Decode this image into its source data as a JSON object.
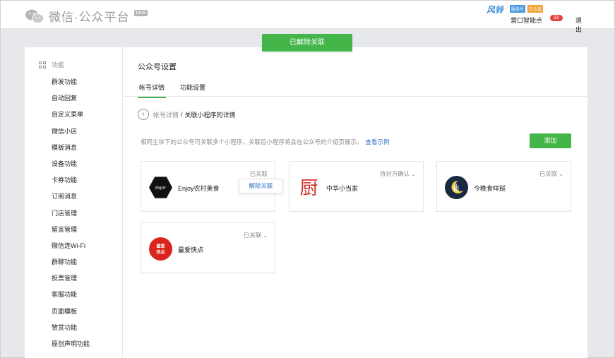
{
  "header": {
    "platform_title": "微信·公众平台",
    "beta_tag": "beta",
    "account_avatar_text": "风铃",
    "badge_1": "服务号",
    "badge_2": "已认证",
    "account_name": "营口智能点",
    "notice_count": "31",
    "logout": "退出"
  },
  "toast": {
    "text": "已解除关联"
  },
  "sidebar": {
    "section_title": "功能",
    "items": [
      "群发功能",
      "自动回复",
      "自定义菜单",
      "微信小店",
      "模板消息",
      "设备功能",
      "卡券功能",
      "订阅消息",
      "门店管理",
      "留言管理",
      "微信连Wi-Fi",
      "群聊功能",
      "投票管理",
      "客服功能",
      "页面模板",
      "赞赏功能",
      "原创声明功能"
    ]
  },
  "main": {
    "title": "公众号设置",
    "tabs": [
      {
        "label": "帐号详情",
        "active": true
      },
      {
        "label": "功能设置",
        "active": false
      }
    ],
    "breadcrumb": {
      "parent": "帐号详情",
      "separator": "/",
      "current": "关联小程序的详情"
    },
    "description": "相同主体下的公众号可关联多个小程序。关联后小程序将会在公众号的介绍页展示。",
    "description_link": "查看示例",
    "add_button": "添加",
    "cards": [
      {
        "name": "Enjoy农村美食",
        "status": "已关联",
        "logo_text": "ENJOY",
        "menu_option": "解除关联"
      },
      {
        "name": "中华小当家",
        "status": "待对方确认",
        "logo_text": "厨"
      },
      {
        "name": "今晚食咩餸",
        "status": "已关联",
        "logo_text": ""
      },
      {
        "name": "最爱快点",
        "status": "已关联",
        "logo_text": "最爱快点"
      }
    ]
  },
  "colors": {
    "accent_green": "#44b549",
    "link_blue": "#2e70c6",
    "notice_red": "#e64340"
  }
}
